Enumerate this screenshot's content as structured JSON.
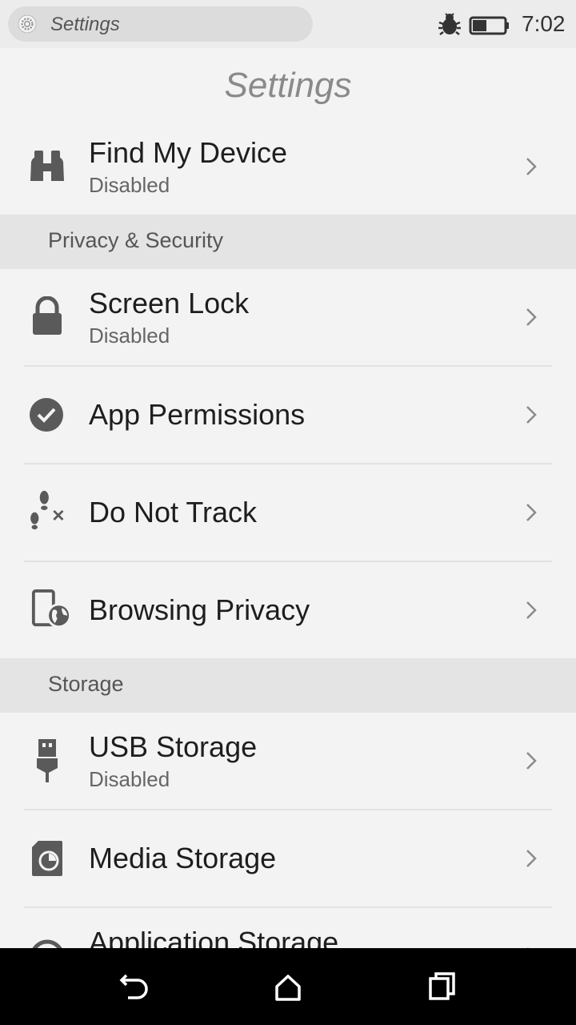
{
  "status_bar": {
    "url_text": "Settings",
    "time": "7:02"
  },
  "header": {
    "title": "Settings"
  },
  "items": {
    "find_my_device": {
      "title": "Find My Device",
      "subtitle": "Disabled",
      "icon": "binoculars-icon"
    },
    "screen_lock": {
      "title": "Screen Lock",
      "subtitle": "Disabled",
      "icon": "lock-icon"
    },
    "app_permissions": {
      "title": "App Permissions",
      "icon": "check-circle-icon"
    },
    "do_not_track": {
      "title": "Do Not Track",
      "icon": "footprints-x-icon"
    },
    "browsing_privacy": {
      "title": "Browsing Privacy",
      "icon": "phone-globe-icon"
    },
    "usb_storage": {
      "title": "USB Storage",
      "subtitle": "Disabled",
      "icon": "usb-icon"
    },
    "media_storage": {
      "title": "Media Storage",
      "icon": "sd-card-icon"
    },
    "application_storage": {
      "title": "Application Storage",
      "icon": "app-storage-icon"
    }
  },
  "sections": {
    "privacy": "Privacy & Security",
    "storage": "Storage"
  },
  "colors": {
    "background": "#f3f3f3",
    "section_background": "#e4e4e4",
    "icon": "#5a5a5a",
    "nav_bar": "#000000"
  }
}
